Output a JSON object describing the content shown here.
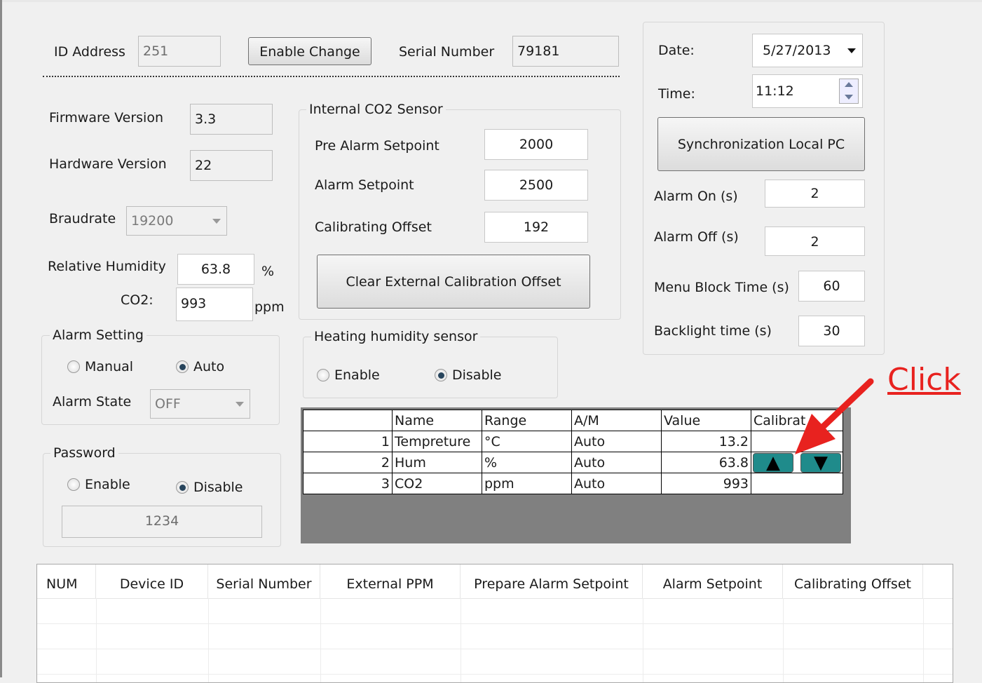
{
  "top": {
    "id_address_label": "ID Address",
    "id_address_value": "251",
    "enable_change_label": "Enable Change",
    "serial_number_label": "Serial Number",
    "serial_number_value": "79181"
  },
  "info": {
    "firmware_label": "Firmware Version",
    "firmware_value": "3.3",
    "hardware_label": "Hardware Version",
    "hardware_value": "22",
    "baudrate_label": "Braudrate",
    "baudrate_value": "19200",
    "humidity_label": "Relative Humidity",
    "humidity_value": "63.8",
    "humidity_unit": "%",
    "co2_label": "CO2:",
    "co2_value": "993",
    "co2_unit": "ppm"
  },
  "co2_sensor": {
    "title": "Internal CO2 Sensor",
    "pre_alarm_label": "Pre Alarm Setpoint",
    "pre_alarm_value": "2000",
    "alarm_label": "Alarm Setpoint",
    "alarm_value": "2500",
    "offset_label": "Calibrating Offset",
    "offset_value": "192",
    "clear_button": "Clear External Calibration Offset"
  },
  "datetime": {
    "date_label": "Date:",
    "date_value": "5/27/2013",
    "time_label": "Time:",
    "time_value": "11:12",
    "sync_button": "Synchronization Local PC",
    "alarm_on_label": "Alarm On (s)",
    "alarm_on_value": "2",
    "alarm_off_label": "Alarm Off (s)",
    "alarm_off_value": "2",
    "menu_block_label": "Menu Block Time (s)",
    "menu_block_value": "60",
    "backlight_label": "Backlight time (s)",
    "backlight_value": "30"
  },
  "alarm_setting": {
    "title": "Alarm Setting",
    "manual_label": "Manual",
    "auto_label": "Auto",
    "selected": "Auto",
    "state_label": "Alarm State",
    "state_value": "OFF"
  },
  "heating": {
    "title": "Heating humidity sensor",
    "enable_label": "Enable",
    "disable_label": "Disable",
    "selected": "Disable"
  },
  "password": {
    "title": "Password",
    "enable_label": "Enable",
    "disable_label": "Disable",
    "selected": "Disable",
    "value": "1234"
  },
  "grid": {
    "headers": [
      "",
      "Name",
      "Range",
      "A/M",
      "Value",
      "Calibrat"
    ],
    "rows": [
      {
        "num": "1",
        "name": "Tempreture",
        "range": "°C",
        "am": "Auto",
        "value": "13.2"
      },
      {
        "num": "2",
        "name": "Hum",
        "range": "%",
        "am": "Auto",
        "value": "63.8"
      },
      {
        "num": "3",
        "name": "CO2",
        "range": "ppm",
        "am": "Auto",
        "value": "993"
      }
    ]
  },
  "annotation": {
    "click_text": "Click",
    "color": "#e8221f"
  },
  "list": {
    "headers": [
      "NUM",
      "Device ID",
      "Serial Number",
      "External PPM",
      "Prepare Alarm Setpoint",
      "Alarm Setpoint",
      "Calibrating Offset"
    ]
  }
}
